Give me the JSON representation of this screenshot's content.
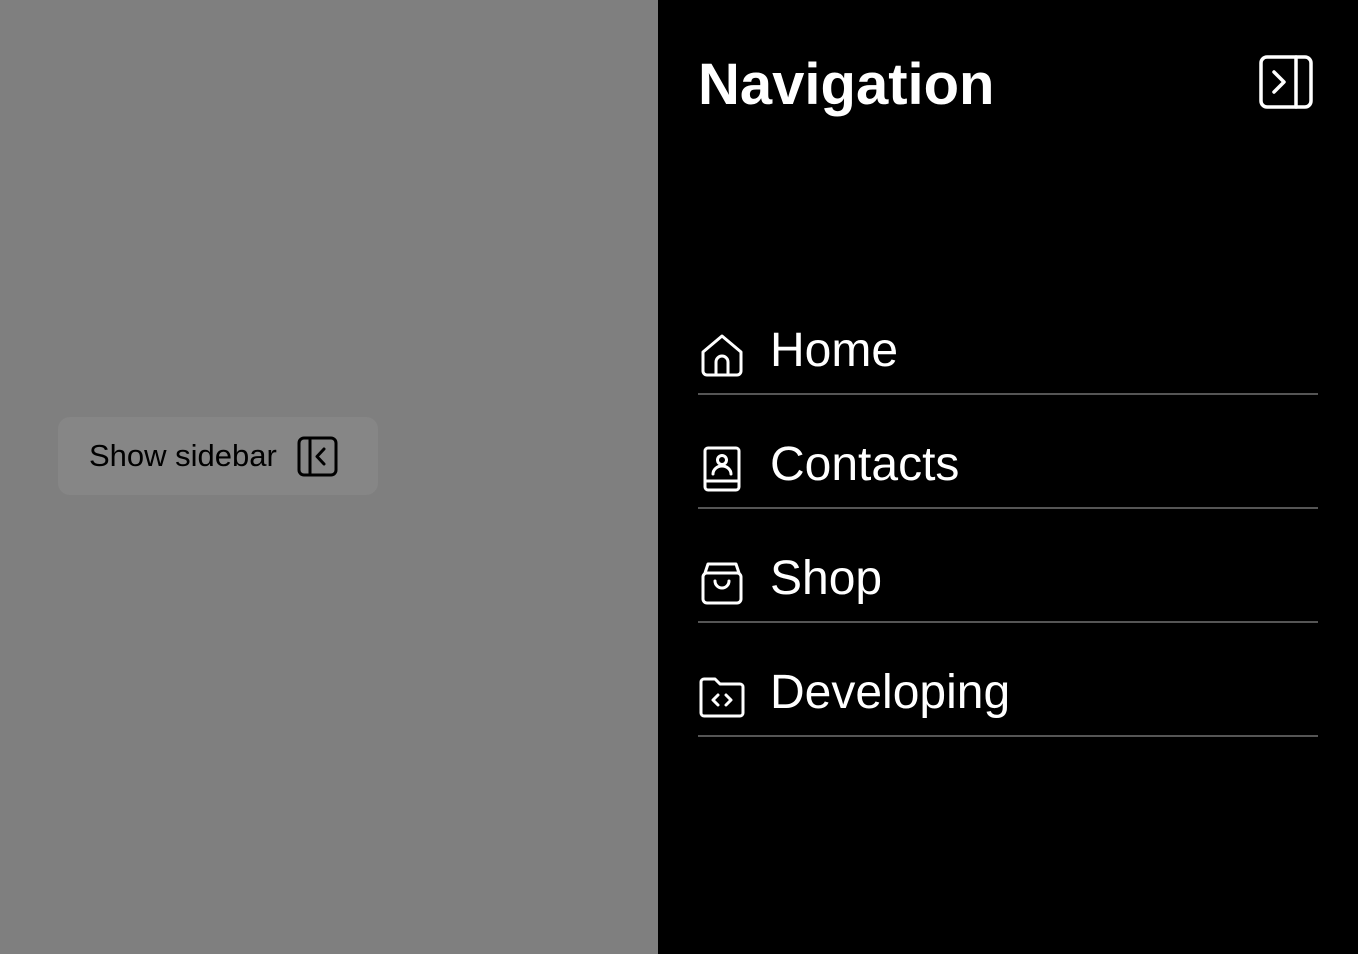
{
  "overlay": {
    "show_sidebar_label": "Show sidebar",
    "show_sidebar_icon": "sidebar-expand-icon"
  },
  "sidebar": {
    "title": "Navigation",
    "collapse_icon": "sidebar-collapse-icon",
    "items": [
      {
        "label": "Home",
        "icon": "home-icon"
      },
      {
        "label": "Contacts",
        "icon": "contact-book-icon"
      },
      {
        "label": "Shop",
        "icon": "shopping-bag-icon"
      },
      {
        "label": "Developing",
        "icon": "code-folder-icon"
      }
    ]
  },
  "colors": {
    "overlay_bg": "#7f7f7f",
    "sidebar_bg": "#000000",
    "text_light": "#ffffff",
    "divider": "#555555"
  }
}
